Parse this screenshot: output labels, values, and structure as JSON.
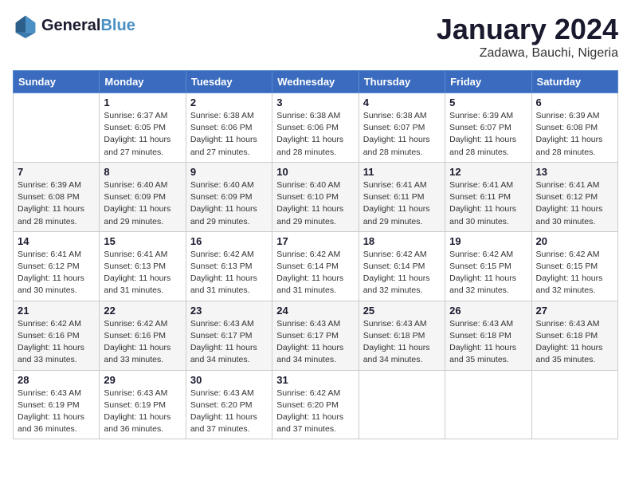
{
  "header": {
    "logo_line1": "General",
    "logo_line2": "Blue",
    "month": "January 2024",
    "location": "Zadawa, Bauchi, Nigeria"
  },
  "days_of_week": [
    "Sunday",
    "Monday",
    "Tuesday",
    "Wednesday",
    "Thursday",
    "Friday",
    "Saturday"
  ],
  "weeks": [
    [
      {
        "day": "",
        "content": ""
      },
      {
        "day": "1",
        "content": "Sunrise: 6:37 AM\nSunset: 6:05 PM\nDaylight: 11 hours\nand 27 minutes."
      },
      {
        "day": "2",
        "content": "Sunrise: 6:38 AM\nSunset: 6:06 PM\nDaylight: 11 hours\nand 27 minutes."
      },
      {
        "day": "3",
        "content": "Sunrise: 6:38 AM\nSunset: 6:06 PM\nDaylight: 11 hours\nand 28 minutes."
      },
      {
        "day": "4",
        "content": "Sunrise: 6:38 AM\nSunset: 6:07 PM\nDaylight: 11 hours\nand 28 minutes."
      },
      {
        "day": "5",
        "content": "Sunrise: 6:39 AM\nSunset: 6:07 PM\nDaylight: 11 hours\nand 28 minutes."
      },
      {
        "day": "6",
        "content": "Sunrise: 6:39 AM\nSunset: 6:08 PM\nDaylight: 11 hours\nand 28 minutes."
      }
    ],
    [
      {
        "day": "7",
        "content": "Sunrise: 6:39 AM\nSunset: 6:08 PM\nDaylight: 11 hours\nand 28 minutes."
      },
      {
        "day": "8",
        "content": "Sunrise: 6:40 AM\nSunset: 6:09 PM\nDaylight: 11 hours\nand 29 minutes."
      },
      {
        "day": "9",
        "content": "Sunrise: 6:40 AM\nSunset: 6:09 PM\nDaylight: 11 hours\nand 29 minutes."
      },
      {
        "day": "10",
        "content": "Sunrise: 6:40 AM\nSunset: 6:10 PM\nDaylight: 11 hours\nand 29 minutes."
      },
      {
        "day": "11",
        "content": "Sunrise: 6:41 AM\nSunset: 6:11 PM\nDaylight: 11 hours\nand 29 minutes."
      },
      {
        "day": "12",
        "content": "Sunrise: 6:41 AM\nSunset: 6:11 PM\nDaylight: 11 hours\nand 30 minutes."
      },
      {
        "day": "13",
        "content": "Sunrise: 6:41 AM\nSunset: 6:12 PM\nDaylight: 11 hours\nand 30 minutes."
      }
    ],
    [
      {
        "day": "14",
        "content": "Sunrise: 6:41 AM\nSunset: 6:12 PM\nDaylight: 11 hours\nand 30 minutes."
      },
      {
        "day": "15",
        "content": "Sunrise: 6:41 AM\nSunset: 6:13 PM\nDaylight: 11 hours\nand 31 minutes."
      },
      {
        "day": "16",
        "content": "Sunrise: 6:42 AM\nSunset: 6:13 PM\nDaylight: 11 hours\nand 31 minutes."
      },
      {
        "day": "17",
        "content": "Sunrise: 6:42 AM\nSunset: 6:14 PM\nDaylight: 11 hours\nand 31 minutes."
      },
      {
        "day": "18",
        "content": "Sunrise: 6:42 AM\nSunset: 6:14 PM\nDaylight: 11 hours\nand 32 minutes."
      },
      {
        "day": "19",
        "content": "Sunrise: 6:42 AM\nSunset: 6:15 PM\nDaylight: 11 hours\nand 32 minutes."
      },
      {
        "day": "20",
        "content": "Sunrise: 6:42 AM\nSunset: 6:15 PM\nDaylight: 11 hours\nand 32 minutes."
      }
    ],
    [
      {
        "day": "21",
        "content": "Sunrise: 6:42 AM\nSunset: 6:16 PM\nDaylight: 11 hours\nand 33 minutes."
      },
      {
        "day": "22",
        "content": "Sunrise: 6:42 AM\nSunset: 6:16 PM\nDaylight: 11 hours\nand 33 minutes."
      },
      {
        "day": "23",
        "content": "Sunrise: 6:43 AM\nSunset: 6:17 PM\nDaylight: 11 hours\nand 34 minutes."
      },
      {
        "day": "24",
        "content": "Sunrise: 6:43 AM\nSunset: 6:17 PM\nDaylight: 11 hours\nand 34 minutes."
      },
      {
        "day": "25",
        "content": "Sunrise: 6:43 AM\nSunset: 6:18 PM\nDaylight: 11 hours\nand 34 minutes."
      },
      {
        "day": "26",
        "content": "Sunrise: 6:43 AM\nSunset: 6:18 PM\nDaylight: 11 hours\nand 35 minutes."
      },
      {
        "day": "27",
        "content": "Sunrise: 6:43 AM\nSunset: 6:18 PM\nDaylight: 11 hours\nand 35 minutes."
      }
    ],
    [
      {
        "day": "28",
        "content": "Sunrise: 6:43 AM\nSunset: 6:19 PM\nDaylight: 11 hours\nand 36 minutes."
      },
      {
        "day": "29",
        "content": "Sunrise: 6:43 AM\nSunset: 6:19 PM\nDaylight: 11 hours\nand 36 minutes."
      },
      {
        "day": "30",
        "content": "Sunrise: 6:43 AM\nSunset: 6:20 PM\nDaylight: 11 hours\nand 37 minutes."
      },
      {
        "day": "31",
        "content": "Sunrise: 6:42 AM\nSunset: 6:20 PM\nDaylight: 11 hours\nand 37 minutes."
      },
      {
        "day": "",
        "content": ""
      },
      {
        "day": "",
        "content": ""
      },
      {
        "day": "",
        "content": ""
      }
    ]
  ]
}
